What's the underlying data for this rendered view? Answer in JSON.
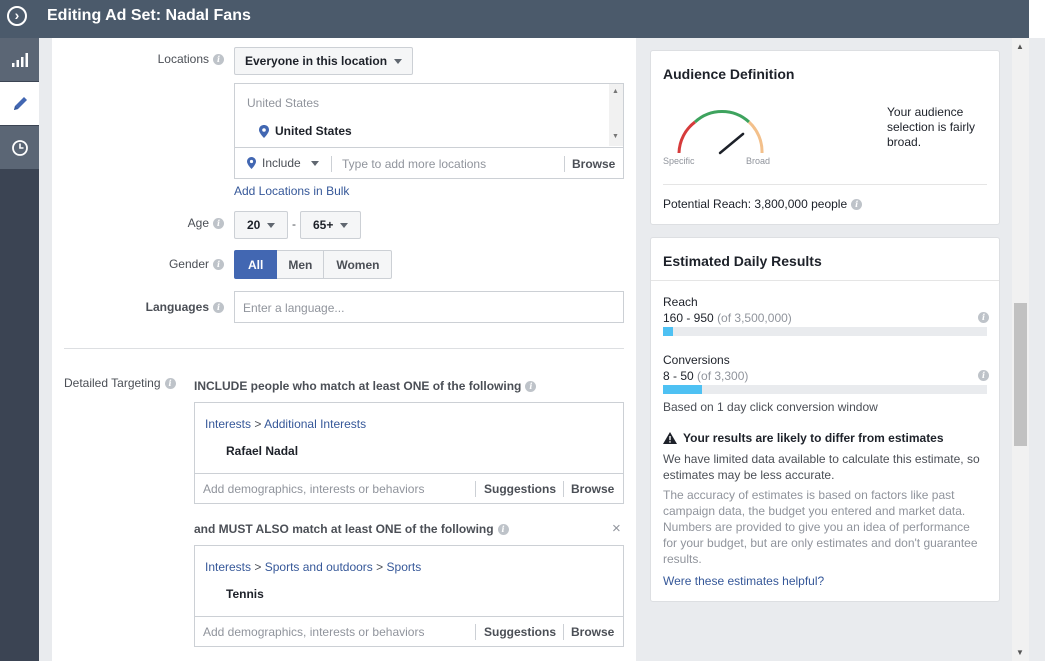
{
  "header": {
    "title": "Editing Ad Set: Nadal Fans"
  },
  "nav": {
    "items": [
      {
        "name": "reporting",
        "icon": "bar-chart-icon"
      },
      {
        "name": "edit",
        "icon": "pencil-icon"
      },
      {
        "name": "history",
        "icon": "clock-icon"
      }
    ]
  },
  "form": {
    "locations": {
      "label": "Locations",
      "dropdown": "Everyone in this location",
      "list_header": "United States",
      "selected": "United States",
      "include": "Include",
      "placeholder": "Type to add more locations",
      "browse": "Browse",
      "bulk_link": "Add Locations in Bulk"
    },
    "age": {
      "label": "Age",
      "min": "20",
      "dash": "-",
      "max": "65+"
    },
    "gender": {
      "label": "Gender",
      "options": [
        "All",
        "Men",
        "Women"
      ],
      "selected": "All"
    },
    "languages": {
      "label": "Languages",
      "placeholder": "Enter a language..."
    },
    "detailed": {
      "label": "Detailed Targeting",
      "include_heading": "INCLUDE people who match at least ONE of the following",
      "group1": {
        "path": [
          "Interests",
          "Additional Interests"
        ],
        "sep": ">",
        "item": "Rafael Nadal",
        "placeholder": "Add demographics, interests or behaviors",
        "suggestions": "Suggestions",
        "browse": "Browse"
      },
      "must_heading": "and MUST ALSO match at least ONE of the following",
      "close": "×",
      "group2": {
        "path": [
          "Interests",
          "Sports and outdoors",
          "Sports"
        ],
        "sep": ">",
        "item": "Tennis",
        "placeholder": "Add demographics, interests or behaviors",
        "suggestions": "Suggestions",
        "browse": "Browse"
      }
    }
  },
  "audience": {
    "title": "Audience Definition",
    "specific": "Specific",
    "broad": "Broad",
    "description": "Your audience selection is fairly broad.",
    "reach_label": "Potential Reach: 3,800,000 people",
    "gauge_value": 0.78
  },
  "estimates": {
    "title": "Estimated Daily Results",
    "reach": {
      "label": "Reach",
      "value": "160 - 950",
      "of": "(of 3,500,000)",
      "fraction": 0.03
    },
    "conversions": {
      "label": "Conversions",
      "value": "8 - 50",
      "of": "(of 3,300)",
      "fraction": 0.12
    },
    "window": "Based on 1 day click conversion window",
    "warning_title": "Your results are likely to differ from estimates",
    "warning_text": "We have limited data available to calculate this estimate, so estimates may be less accurate.",
    "accuracy_text": "The accuracy of estimates is based on factors like past campaign data, the budget you entered and market data. Numbers are provided to give you an idea of performance for your budget, but are only estimates and don't guarantee results.",
    "helpful_link": "Were these estimates helpful?"
  },
  "colors": {
    "topbar": "#4b5a6b",
    "accent": "#4267b2",
    "bar": "#4ec1f3",
    "link": "#365899"
  }
}
